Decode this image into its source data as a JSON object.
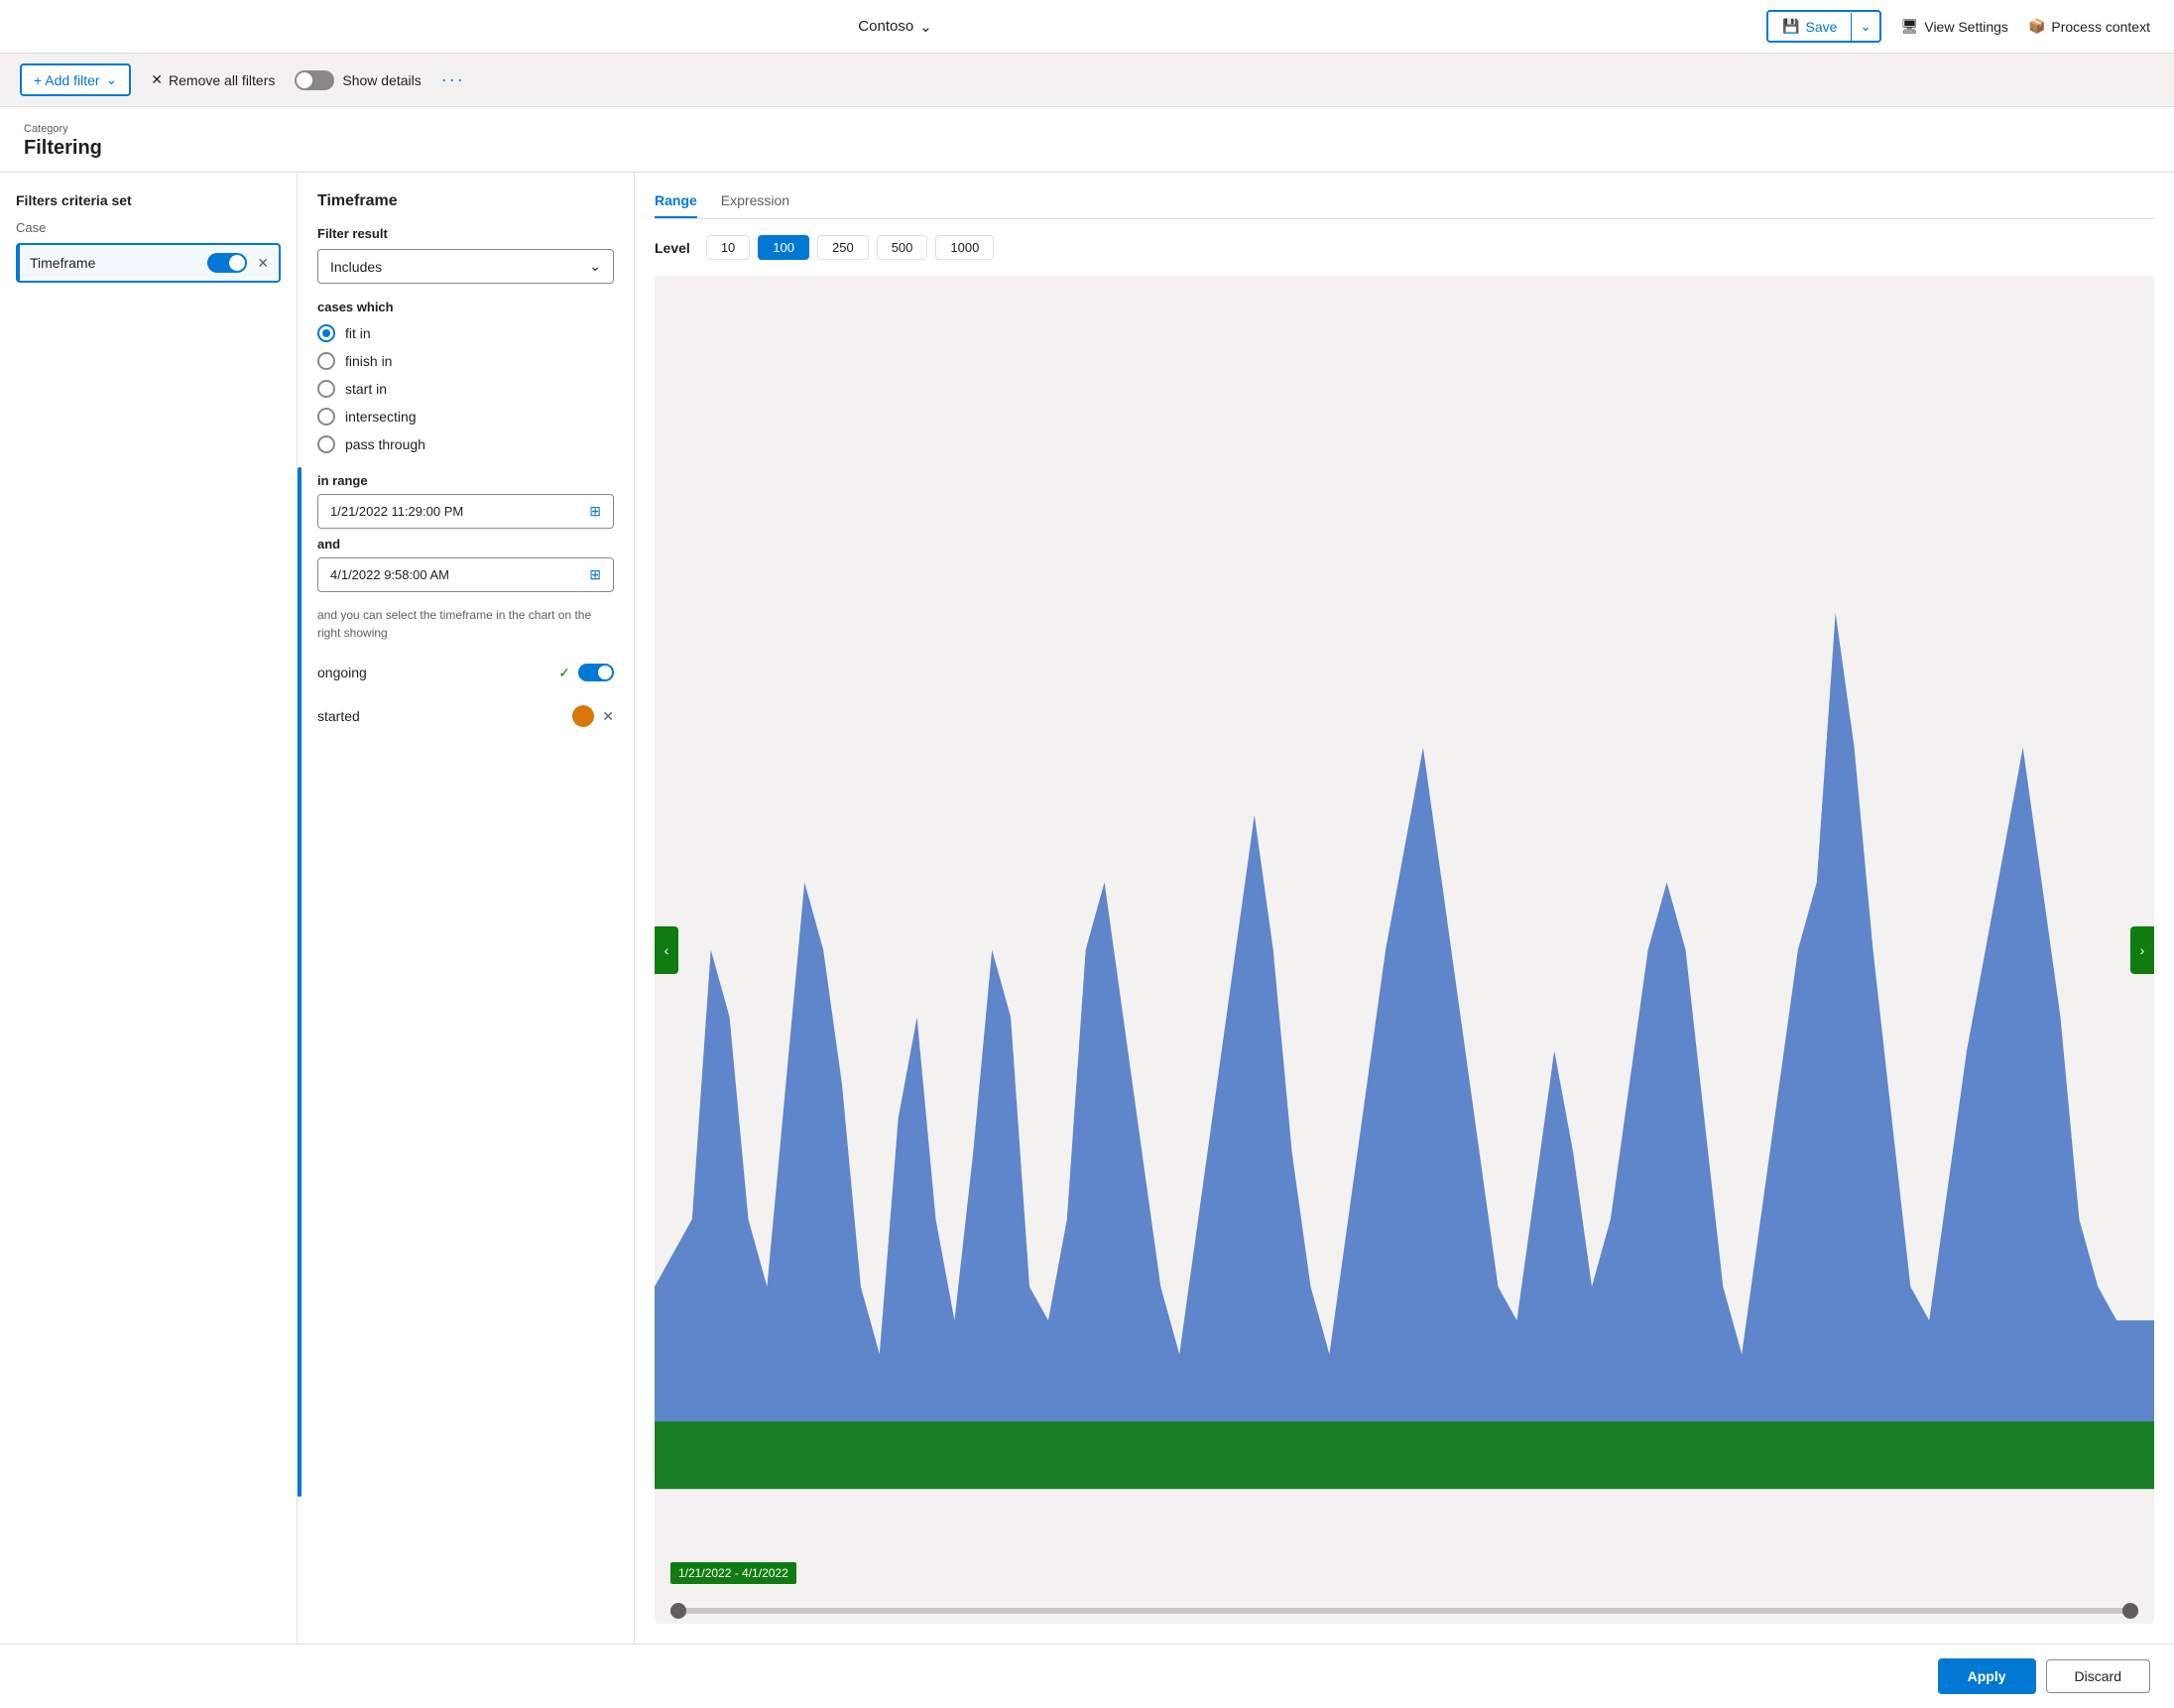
{
  "topnav": {
    "company": "Contoso",
    "save_label": "Save",
    "view_settings_label": "View Settings",
    "process_context_label": "Process context"
  },
  "toolbar": {
    "add_filter_label": "+ Add filter",
    "remove_filters_label": "Remove all filters",
    "show_details_label": "Show details",
    "more_label": "···"
  },
  "category": {
    "label": "Category",
    "title": "Filtering"
  },
  "left_panel": {
    "section_title": "Filters criteria set",
    "case_label": "Case",
    "filter_item_name": "Timeframe"
  },
  "middle_panel": {
    "title": "Timeframe",
    "filter_result_label": "Filter result",
    "filter_result_value": "Includes",
    "cases_which_label": "cases which",
    "radio_options": [
      {
        "id": "fit_in",
        "label": "fit in",
        "selected": true
      },
      {
        "id": "finish_in",
        "label": "finish in",
        "selected": false
      },
      {
        "id": "start_in",
        "label": "start in",
        "selected": false
      },
      {
        "id": "intersecting",
        "label": "intersecting",
        "selected": false
      },
      {
        "id": "pass_through",
        "label": "pass through",
        "selected": false
      }
    ],
    "in_range_label": "in range",
    "date_start": "1/21/2022 11:29:00 PM",
    "and_label": "and",
    "date_end": "4/1/2022 9:58:00 AM",
    "hint_text": "and you can select the timeframe in the chart on the right showing",
    "ongoing_label": "ongoing",
    "started_label": "started"
  },
  "right_panel": {
    "tab_range": "Range",
    "tab_expression": "Expression",
    "level_label": "Level",
    "levels": [
      "10",
      "100",
      "250",
      "500",
      "1000"
    ],
    "active_level": "100",
    "chart_date_label": "1/21/2022 - 4/1/2022"
  },
  "bottom_bar": {
    "apply_label": "Apply",
    "discard_label": "Discard"
  }
}
